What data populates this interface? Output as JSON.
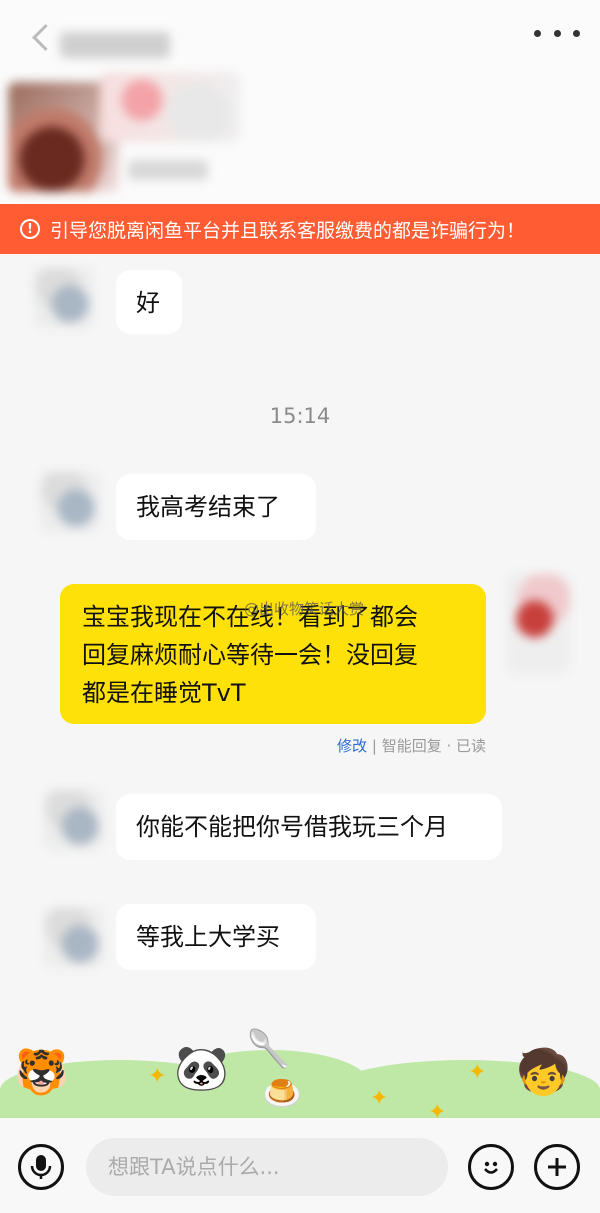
{
  "header": {
    "more_icon": "more-dots-icon",
    "back_icon": "chevron-left-icon"
  },
  "warning": {
    "icon": "alert-circle-icon",
    "text": "引导您脱离闲鱼平台并且联系客服缴费的都是诈骗行为！"
  },
  "messages": [
    {
      "side": "other",
      "text": "好"
    },
    {
      "side": "time",
      "text": "15:14"
    },
    {
      "side": "other",
      "text": "我高考结束了"
    },
    {
      "side": "self",
      "lines": [
        "宝宝我现在不在线！看到了都会",
        "回复麻烦耐心等待一会！没回复",
        "都是在睡觉TvT"
      ]
    },
    {
      "side": "other",
      "text": "你能不能把你号借我玩三个月"
    },
    {
      "side": "other",
      "text": "等我上大学买"
    }
  ],
  "self_meta": {
    "edit": "修改",
    "separator": "|",
    "status": "智能回复 · 已读"
  },
  "watermark": "@出收物笑话大赏",
  "input_bar": {
    "placeholder": "想跟TA说点什么...",
    "voice_icon": "microphone-icon",
    "emoji_icon": "smile-icon",
    "plus_icon": "plus-icon"
  },
  "colors": {
    "warning_bg": "#ff5c33",
    "self_bubble": "#ffe10a",
    "other_bubble": "#ffffff",
    "edit_link": "#2f6bd3"
  }
}
